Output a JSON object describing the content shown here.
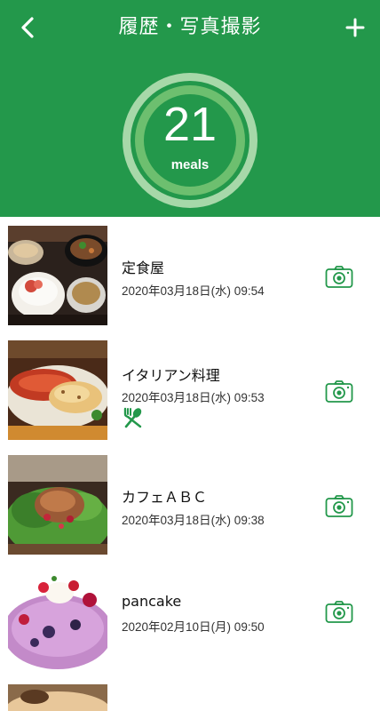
{
  "header": {
    "title": "履歴・写真撮影",
    "back_icon": "chevron-left-icon",
    "add_icon": "plus-icon",
    "background_color": "#23984b"
  },
  "summary": {
    "count": "21",
    "unit": "meals",
    "progress": 1.0
  },
  "meals": [
    {
      "name": "定食屋",
      "date": "2020年03月18日(水) 09:54",
      "has_fork_icon": false
    },
    {
      "name": "イタリアン料理",
      "date": "2020年03月18日(水) 09:53",
      "has_fork_icon": true
    },
    {
      "name": "カフェＡＢＣ",
      "date": "2020年03月18日(水) 09:38",
      "has_fork_icon": false
    },
    {
      "name": "pancake",
      "date": "2020年02月10日(月) 09:50",
      "has_fork_icon": false
    }
  ],
  "icons": {
    "camera": "camera-icon",
    "fork": "fork-spoon-icon"
  }
}
